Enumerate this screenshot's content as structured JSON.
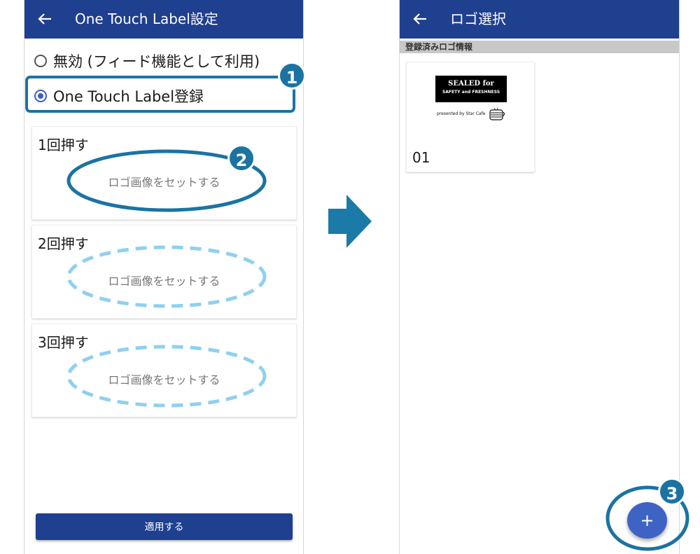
{
  "left_screen": {
    "appbar": {
      "title": "One Touch Label設定",
      "back_icon": "arrow-left-icon"
    },
    "options": [
      {
        "label": "無効 (フィード機能として利用)",
        "selected": false
      },
      {
        "label": "One Touch Label登録",
        "selected": true
      }
    ],
    "cards": [
      {
        "title": "1回押す",
        "hint": "ロゴ画像をセットする"
      },
      {
        "title": "2回押す",
        "hint": "ロゴ画像をセットする"
      },
      {
        "title": "3回押す",
        "hint": "ロゴ画像をセットする"
      }
    ],
    "apply_label": "適用する"
  },
  "right_screen": {
    "appbar": {
      "title": "ロゴ選択",
      "back_icon": "arrow-left-icon"
    },
    "section_header": "登録済みロゴ情報",
    "logos": [
      {
        "name": "01",
        "line1": "SEALED for",
        "line2": "SAFETY and FRESHNESS",
        "presented": "presented by Star Cafe"
      }
    ],
    "fab_label": "+"
  },
  "callouts": [
    "1",
    "2",
    "3"
  ],
  "colors": {
    "appbar": "#1f3f8f",
    "accent": "#1b73a2",
    "dashed": "#8fd0ee",
    "radio": "#3b5dc9"
  }
}
